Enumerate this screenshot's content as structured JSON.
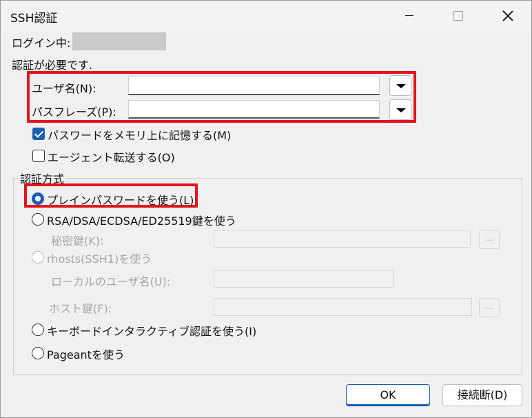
{
  "window": {
    "title": "SSH認証"
  },
  "login": {
    "label": "ログイン中:"
  },
  "auth_required": "認証が必要です.",
  "username": {
    "label": "ユーザ名(N):",
    "value": ""
  },
  "passphrase": {
    "label": "パスフレーズ(P):",
    "value": ""
  },
  "checkboxes": {
    "remember_password": {
      "label": "パスワードをメモリ上に記憶する(M)",
      "checked": true
    },
    "agent_forward": {
      "label": "エージェント転送する(O)",
      "checked": false
    }
  },
  "auth_method": {
    "group_label": "認証方式",
    "plain_password": "プレインパスワードを使う(L)",
    "key_auth": "RSA/DSA/ECDSA/ED25519鍵を使う",
    "private_key_label": "秘密鍵(K):",
    "rhosts": "rhosts(SSH1)を使う",
    "local_user_label": "ローカルのユーザ名(U):",
    "host_key_label": "ホスト鍵(F):",
    "keyboard_interactive": "キーボードインタラクティブ認証を使う(I)",
    "pageant": "Pageantを使う",
    "selected": "plain_password"
  },
  "browse_label": "...",
  "buttons": {
    "ok": "OK",
    "disconnect": "接続断(D)"
  },
  "colors": {
    "highlight": "#e3141b",
    "accent": "#1a5fb4"
  }
}
